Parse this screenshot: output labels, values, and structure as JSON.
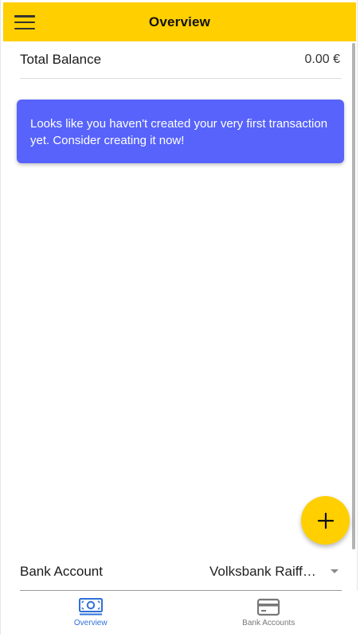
{
  "header": {
    "title": "Overview",
    "menu_icon": "hamburger-menu-icon",
    "color": "#ffcf00"
  },
  "balance": {
    "label": "Total Balance",
    "value": "0.00 €"
  },
  "notice": {
    "text": "Looks like you haven't created your very first transaction yet. Consider creating it now!",
    "color": "#5763fb"
  },
  "fab": {
    "icon": "plus-icon"
  },
  "account": {
    "label": "Bank Account",
    "selected": "Volksbank Raiffeisenbank"
  },
  "nav": {
    "items": [
      {
        "label": "Overview",
        "icon": "banknote-icon",
        "active": true
      },
      {
        "label": "Bank Accounts",
        "icon": "credit-card-icon",
        "active": false
      }
    ],
    "active_color": "#2f6fd8",
    "inactive_color": "#777777"
  }
}
